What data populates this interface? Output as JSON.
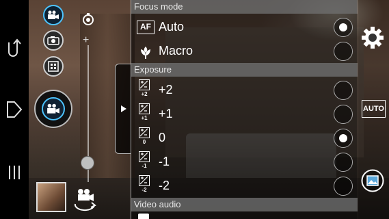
{
  "settings": {
    "focus_mode": {
      "header": "Focus mode",
      "options": [
        {
          "label": "Auto",
          "selected": true,
          "icon": "af-icon",
          "icon_text": "AF"
        },
        {
          "label": "Macro",
          "selected": false,
          "icon": "macro-flower-icon"
        }
      ]
    },
    "exposure": {
      "header": "Exposure",
      "options": [
        {
          "label": "+2",
          "sub": "+2",
          "selected": false
        },
        {
          "label": "+1",
          "sub": "+1",
          "selected": false
        },
        {
          "label": "0",
          "sub": "0",
          "selected": true
        },
        {
          "label": "-1",
          "sub": "-1",
          "selected": false
        },
        {
          "label": "-2",
          "sub": "-2",
          "selected": false
        }
      ]
    },
    "video_audio": {
      "header": "Video audio"
    }
  },
  "right_bar": {
    "scene_badge": "AUTO"
  },
  "icons": {
    "nav": [
      "back-icon",
      "home-icon",
      "recent-apps-icon"
    ],
    "modes": [
      "video-camera-icon",
      "photo-camera-icon",
      "panorama-icon"
    ],
    "others": [
      "timer-icon",
      "shutter-icon",
      "switch-camera-icon",
      "settings-gear-icon",
      "gallery-icon",
      "panel-expand-arrow-icon"
    ]
  },
  "colors": {
    "accent": "#4cc3ff",
    "section_header": "#6e6e6e"
  }
}
